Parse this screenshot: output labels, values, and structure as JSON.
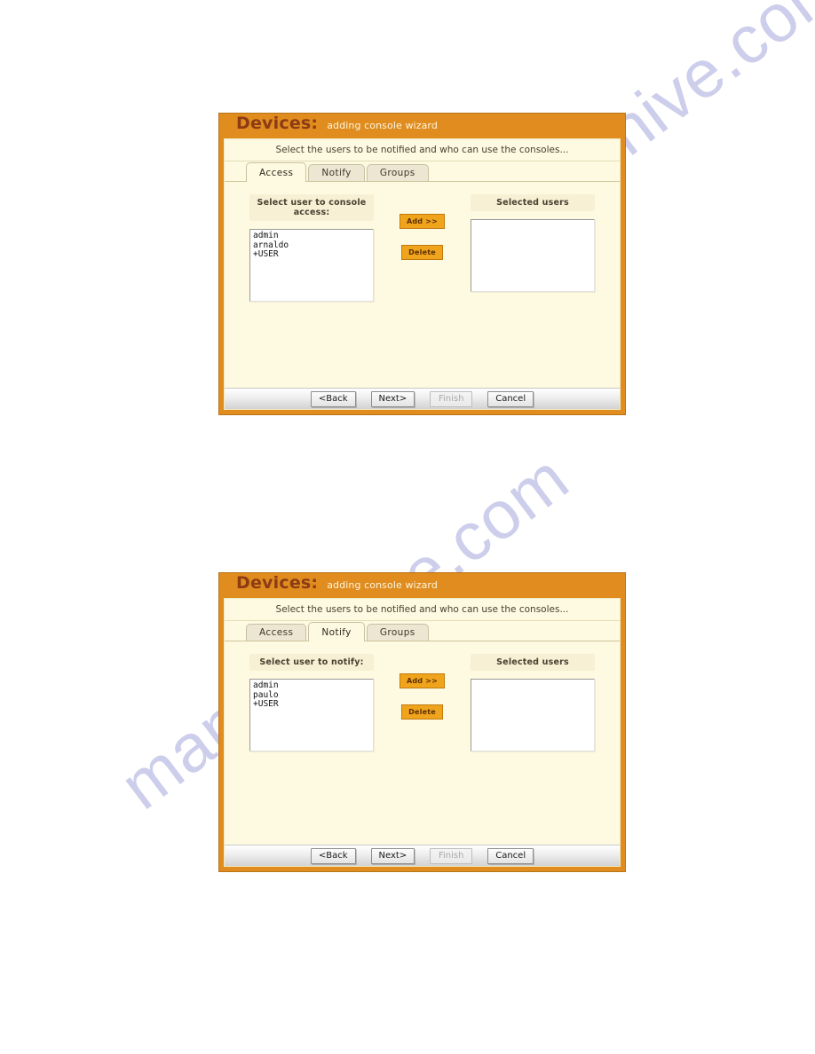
{
  "watermarks": {
    "top": "manualshive.com",
    "bottom": "manualshive.com"
  },
  "dialogs": [
    {
      "title": "Devices:",
      "subtitle": "adding console wizard",
      "instruction": "Select the users to be notified and who can use the consoles...",
      "tabs": [
        {
          "label": "Access",
          "active": true
        },
        {
          "label": "Notify",
          "active": false
        },
        {
          "label": "Groups",
          "active": false
        }
      ],
      "left_panel": {
        "header": "Select user to console access:",
        "items": [
          "admin",
          "arnaldo",
          "+USER"
        ]
      },
      "right_panel": {
        "header": "Selected users",
        "items": []
      },
      "transfer_buttons": {
        "add_label": "Add >>",
        "delete_label": "Delete"
      },
      "footer_buttons": [
        {
          "label": "<Back",
          "disabled": false
        },
        {
          "label": "Next>",
          "disabled": false
        },
        {
          "label": "Finish",
          "disabled": true
        },
        {
          "label": "Cancel",
          "disabled": false
        }
      ]
    },
    {
      "title": "Devices:",
      "subtitle": "adding console wizard",
      "instruction": "Select the users to be notified and who can use the consoles...",
      "tabs": [
        {
          "label": "Access",
          "active": false
        },
        {
          "label": "Notify",
          "active": true
        },
        {
          "label": "Groups",
          "active": false
        }
      ],
      "left_panel": {
        "header": "Select user to notify:",
        "items": [
          "admin",
          "paulo",
          "+USER"
        ]
      },
      "right_panel": {
        "header": "Selected users",
        "items": []
      },
      "transfer_buttons": {
        "add_label": "Add >>",
        "delete_label": "Delete"
      },
      "footer_buttons": [
        {
          "label": "<Back",
          "disabled": false
        },
        {
          "label": "Next>",
          "disabled": false
        },
        {
          "label": "Finish",
          "disabled": true
        },
        {
          "label": "Cancel",
          "disabled": false
        }
      ]
    }
  ],
  "colors": {
    "frame_orange": "#e08c1e",
    "title_brown": "#8c3b14",
    "panel_cream": "#fdfae1",
    "button_orange": "#f0a41c",
    "watermark": "#c9caea"
  }
}
